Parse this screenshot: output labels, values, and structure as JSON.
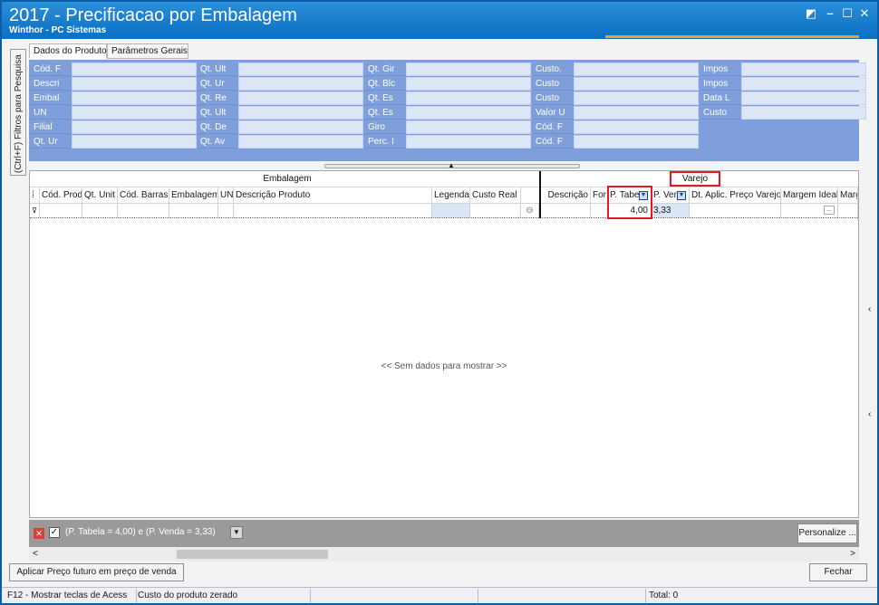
{
  "window": {
    "title": "2017 - Precificacao por Embalagem",
    "subtitle": "Winthor - PC Sistemas",
    "controls": {
      "restore": "◩",
      "minimize": "–",
      "maximize": "☐",
      "close": "✕"
    }
  },
  "side_tab": {
    "label": "(Ctrl+F) Filtros para Pesquisa"
  },
  "tabs": [
    {
      "label": "Dados do Produto"
    },
    {
      "label": "Parâmetros Gerais"
    }
  ],
  "filter_panel": {
    "col1": [
      "Cód. F",
      "Descri",
      "Embal",
      "UN",
      "Filial",
      "Qt. Ur"
    ],
    "col2": [
      "Qt. Ult",
      "Qt. Ur",
      "Qt. Re",
      "Qt. Ult",
      "Qt. De",
      "Qt. Av"
    ],
    "col3": [
      "Qt. Gir",
      "Qt. Blc",
      "Qt. Es",
      "Qt. Es",
      "Giro",
      "Perc. I"
    ],
    "col4": [
      "Custo.",
      "Custo",
      "Custo",
      "Valor U",
      "Cód. F",
      "Cód. F"
    ],
    "col5": [
      "Impos",
      "Impos",
      "Data L",
      "Custo"
    ]
  },
  "grid": {
    "bands": {
      "embalagem": "Embalagem",
      "varejo": "Varejo"
    },
    "columns": [
      "Cód. Prod",
      "Qt. Unit",
      "Cód. Barras",
      "Embalagem",
      "UN",
      "Descrição Produto",
      "Legenda",
      "Custo Real",
      "Descrição",
      "For",
      "P. Tabe",
      "P. Ven",
      "Dt. Aplic. Preço Varejo",
      "Margem Ideal",
      "Margem"
    ],
    "filter_values": {
      "p_tabela": "4,00",
      "p_venda": "3,33",
      "ellipsis": "..."
    },
    "empty_text": "<< Sem dados para mostrar >>"
  },
  "grid_footer": {
    "filter_text": "(P. Tabela = 4,00) e (P. Venda = 3,33)",
    "customize_label": "Personalize ..."
  },
  "buttons": {
    "apply_future": "Aplicar Preço futuro em preço de venda",
    "close": "Fechar"
  },
  "statusbar": {
    "hint": "F12 - Mostrar teclas de Acess",
    "message": "Custo do produto zerado",
    "total": "Total: 0"
  },
  "colors": {
    "title_bar": "#0b6fc4",
    "filter_panel": "#7f9fdc",
    "highlight": "#e11b22",
    "accent": "#e7a621"
  }
}
